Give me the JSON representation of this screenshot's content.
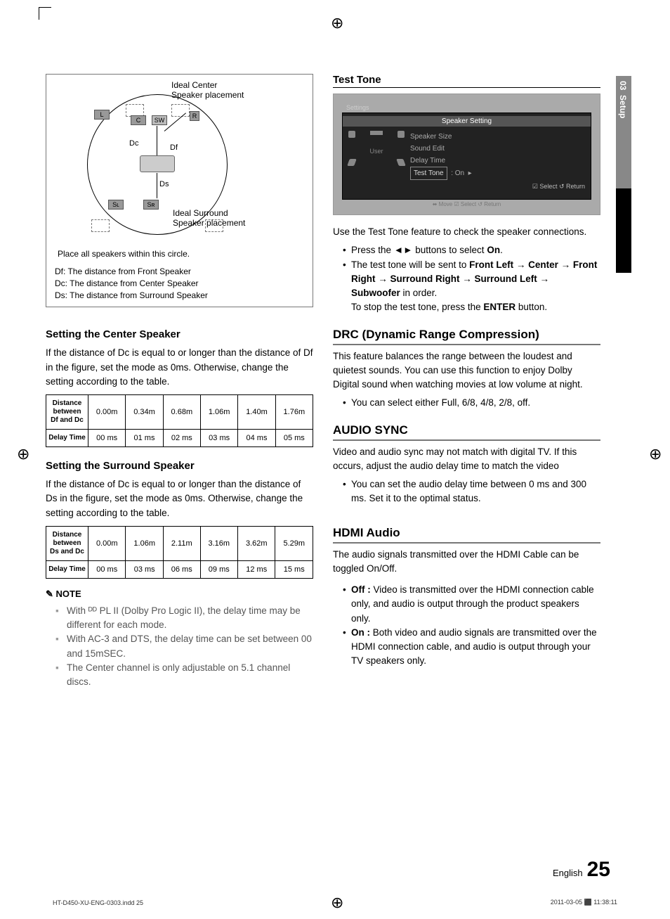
{
  "sidebar": {
    "section_no": "03",
    "section_name": "Setup"
  },
  "diagram": {
    "ideal_center": "Ideal Center\nSpeaker placement",
    "ideal_surround": "Ideal Surround\nSpeaker placement",
    "L": "L",
    "C": "C",
    "SW": "SW",
    "R": "R",
    "Dc": "Dc",
    "Df": "Df",
    "Ds": "Ds",
    "SL": "Sʟ",
    "SR": "Sʀ",
    "circle_note": "Place all speakers within this circle.",
    "df_def": "Df: The distance from Front Speaker",
    "dc_def": "Dc: The distance from Center Speaker",
    "ds_def": "Ds: The distance from Surround Speaker"
  },
  "center_h": "Setting the Center Speaker",
  "center_p": "If the distance of Dc is equal to or longer than the distance of Df in the figure, set the mode as 0ms. Otherwise, change the setting according to the table.",
  "table1": {
    "row1_h": "Distance between Df and Dc",
    "row1": [
      "0.00m",
      "0.34m",
      "0.68m",
      "1.06m",
      "1.40m",
      "1.76m"
    ],
    "row2_h": "Delay Time",
    "row2": [
      "00 ms",
      "01 ms",
      "02 ms",
      "03 ms",
      "04 ms",
      "05 ms"
    ]
  },
  "surround_h": "Setting the Surround Speaker",
  "surround_p": "If the distance of Dc is equal to or longer than the distance of Ds in the figure, set the mode as 0ms. Otherwise, change the setting according to the table.",
  "table2": {
    "row1_h": "Distance between Ds and Dc",
    "row1": [
      "0.00m",
      "1.06m",
      "2.11m",
      "3.16m",
      "3.62m",
      "5.29m"
    ],
    "row2_h": "Delay Time",
    "row2": [
      "00 ms",
      "03 ms",
      "06 ms",
      "09 ms",
      "12 ms",
      "15 ms"
    ]
  },
  "note_label": "NOTE",
  "notes": [
    "With ᴰᴰ PL II (Dolby Pro Logic II), the delay time may be different for each mode.",
    "With AC-3 and DTS, the delay time can be set between 00 and 15mSEC.",
    "The Center channel is only adjustable on 5.1 channel discs."
  ],
  "testtone_h": "Test Tone",
  "tv": {
    "settings": "Settings",
    "title": "Speaker Setting",
    "user": "User",
    "items": [
      "Speaker Size",
      "Sound Edit",
      "Delay Time"
    ],
    "sel_label": "Test Tone",
    "sel_val": ": On",
    "foot_sel": "☑ Select   ↺ Return",
    "foot_move": "⬌ Move   ☑ Select   ↺ Return"
  },
  "testtone_p": "Use the Test Tone feature to check the speaker connections.",
  "testtone_b1_a": "Press the ◄► buttons to select ",
  "testtone_b1_b": "On",
  "testtone_b1_c": ".",
  "testtone_b2_a": "The test tone will be sent to ",
  "testtone_seq": "Front Left → Center → Front Right → Surround Right → Surround Left → Subwoofer",
  "testtone_b2_b": " in order.",
  "testtone_b2_c": "To stop the test tone, press the ",
  "testtone_enter": "ENTER",
  "testtone_b2_d": " button.",
  "drc_h": "DRC (Dynamic Range Compression)",
  "drc_p": "This feature balances the range between the loudest and quietest sounds. You can use this function to enjoy Dolby Digital sound when watching movies at low volume at night.",
  "drc_b": "You can select either Full, 6/8, 4/8, 2/8, off.",
  "audio_h": "AUDIO SYNC",
  "audio_p": "Video and audio sync may not match with digital TV. If this occurs, adjust the audio delay time to match the video",
  "audio_b": "You can set the audio delay time between 0 ms and 300 ms. Set it to the optimal status.",
  "hdmi_h": "HDMI Audio",
  "hdmi_p": "The audio signals transmitted over the HDMI Cable can be toggled On/Off.",
  "hdmi_off_l": "Off :",
  "hdmi_off": " Video is transmitted over the HDMI connection cable only, and audio is output through the product speakers only.",
  "hdmi_on_l": "On :",
  "hdmi_on": " Both video and audio signals are transmitted over the HDMI connection cable, and audio is output through your TV speakers only.",
  "page_lang": "English",
  "page_no": "25",
  "file_l": "HT-D450-XU-ENG-0303.indd   25",
  "file_r": "2011-03-05   ⬛ 11:38:11"
}
